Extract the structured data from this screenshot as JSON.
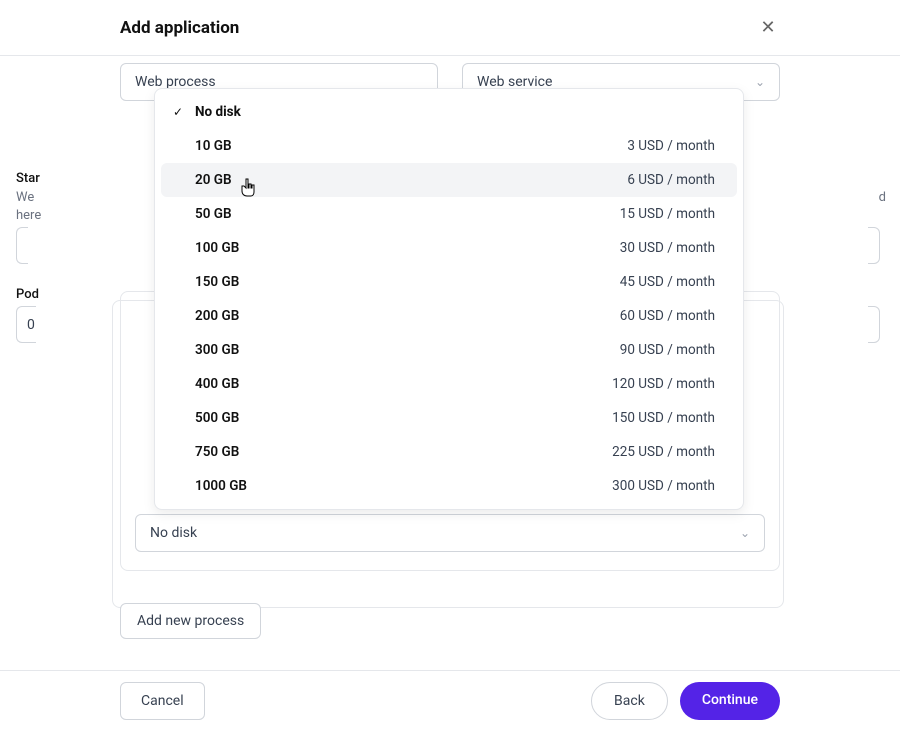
{
  "header": {
    "title": "Add application"
  },
  "form": {
    "process_name": "Web process",
    "service_type": "Web service",
    "start_label_partial": "Star",
    "start_help_line1": "We",
    "start_help_line2": "here",
    "start_help_trail": "d",
    "pod_label_partial": "Pod",
    "pod_value_partial": "0",
    "disk_selected": "No disk"
  },
  "dropdown": {
    "options": [
      {
        "label": "No disk",
        "price": "",
        "selected": true,
        "hovered": false
      },
      {
        "label": "10 GB",
        "price": "3 USD / month",
        "selected": false,
        "hovered": false
      },
      {
        "label": "20 GB",
        "price": "6 USD / month",
        "selected": false,
        "hovered": true
      },
      {
        "label": "50 GB",
        "price": "15 USD / month",
        "selected": false,
        "hovered": false
      },
      {
        "label": "100 GB",
        "price": "30 USD / month",
        "selected": false,
        "hovered": false
      },
      {
        "label": "150 GB",
        "price": "45 USD / month",
        "selected": false,
        "hovered": false
      },
      {
        "label": "200 GB",
        "price": "60 USD / month",
        "selected": false,
        "hovered": false
      },
      {
        "label": "300 GB",
        "price": "90 USD / month",
        "selected": false,
        "hovered": false
      },
      {
        "label": "400 GB",
        "price": "120 USD / month",
        "selected": false,
        "hovered": false
      },
      {
        "label": "500 GB",
        "price": "150 USD / month",
        "selected": false,
        "hovered": false
      },
      {
        "label": "750 GB",
        "price": "225 USD / month",
        "selected": false,
        "hovered": false
      },
      {
        "label": "1000 GB",
        "price": "300 USD / month",
        "selected": false,
        "hovered": false
      }
    ]
  },
  "buttons": {
    "add_process": "Add new process",
    "cancel": "Cancel",
    "back": "Back",
    "continue": "Continue"
  }
}
